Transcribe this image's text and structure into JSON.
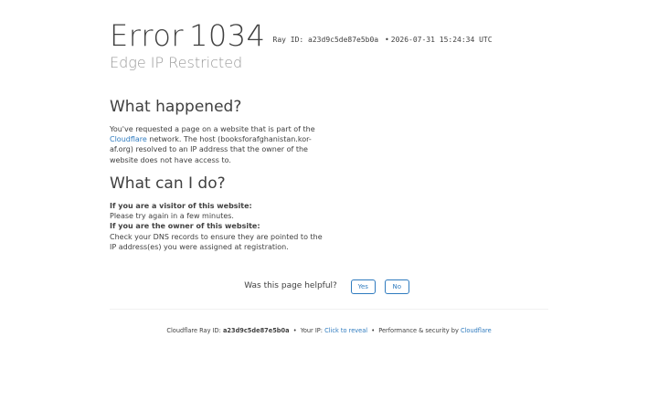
{
  "header": {
    "error_word": "Error",
    "error_code": "1034",
    "ray_label": "Ray ID:",
    "ray_id": "a23d9c5de87e5b0a",
    "separator": "•",
    "timestamp": "2026-07-31 15:24:34 UTC",
    "subtitle": "Edge IP Restricted"
  },
  "what_happened": {
    "heading": "What happened?",
    "text_1": "You've requested a page on a website that is part of the",
    "link": "Cloudflare",
    "text_2": " network. The host (booksforafghanistan.kor-af.org) resolved to an IP address that the owner of the website does not have access to."
  },
  "what_can_i_do": {
    "heading": "What can I do?",
    "visitor_label": "If you are a visitor of this website:",
    "visitor_text": "Please try again in a few minutes.",
    "owner_label": "If you are the owner of this website:",
    "owner_text": "Check your DNS records to ensure they are pointed to the IP address(es) you were assigned at registration."
  },
  "feedback": {
    "question": "Was this page helpful?",
    "yes_label": "Yes",
    "no_label": "No"
  },
  "footer": {
    "ray_prefix": "Cloudflare Ray ID:",
    "ray_id": "a23d9c5de87e5b0a",
    "sep": "•",
    "ip_prefix": "Your IP:",
    "ip_link": "Click to reveal",
    "perf_prefix": "Performance & security by",
    "perf_link": "Cloudflare"
  },
  "colors": {
    "text": "#404040",
    "subtitle": "#999999",
    "link": "#2f7bbf"
  }
}
